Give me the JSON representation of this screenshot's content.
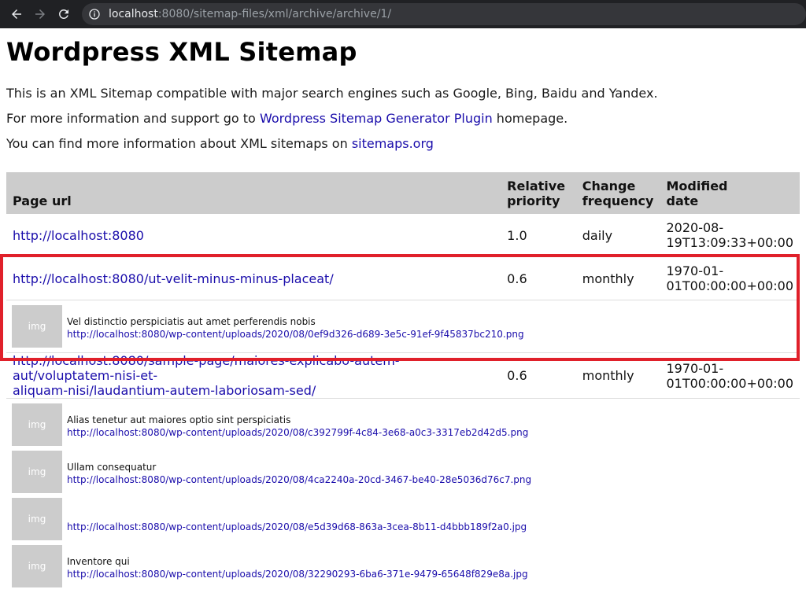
{
  "browser": {
    "url_host": "localhost",
    "url_rest": ":8080/sitemap-files/xml/archive/archive/1/"
  },
  "page": {
    "title": "Wordpress XML Sitemap",
    "intro_line1": "This is an XML Sitemap compatible with major search engines such as Google, Bing, Baidu and Yandex.",
    "intro_line2_prefix": "For more information and support go to ",
    "intro_line2_link": "Wordpress Sitemap Generator Plugin",
    "intro_line2_suffix": " homepage.",
    "intro_line3_prefix": "You can find more information about XML sitemaps on ",
    "intro_line3_link": "sitemaps.org"
  },
  "table": {
    "headers": {
      "url": "Page url",
      "priority_line1": "Relative",
      "priority_line2": "priority",
      "freq_line1": "Change",
      "freq_line2": "frequency",
      "date_line1": "Modified",
      "date_line2": "date"
    },
    "rows": [
      {
        "url": "http://localhost:8080",
        "priority": "1.0",
        "freq": "daily",
        "date_line1": "2020-08-",
        "date_line2": "19T13:09:33+00:00",
        "images": []
      },
      {
        "url": "http://localhost:8080/ut-velit-minus-minus-placeat/",
        "priority": "0.6",
        "freq": "monthly",
        "date_line1": "1970-01-",
        "date_line2": "01T00:00:00+00:00",
        "images": [
          {
            "thumb": "img",
            "caption": "Vel distinctio perspiciatis aut amet perferendis nobis",
            "url": "http://localhost:8080/wp-content/uploads/2020/08/0ef9d326-d689-3e5c-91ef-9f45837bc210.png"
          }
        ]
      },
      {
        "url_line1": "http://localhost:8080/sample-page/maiores-explicabo-autem-aut/voluptatem-nisi-et-",
        "url_line2": "aliquam-nisi/laudantium-autem-laboriosam-sed/",
        "priority": "0.6",
        "freq": "monthly",
        "date_line1": "1970-01-",
        "date_line2": "01T00:00:00+00:00",
        "images": [
          {
            "thumb": "img",
            "caption": "Alias tenetur aut maiores optio sint perspiciatis",
            "url": "http://localhost:8080/wp-content/uploads/2020/08/c392799f-4c84-3e68-a0c3-3317eb2d42d5.png"
          },
          {
            "thumb": "img",
            "caption": "Ullam consequatur",
            "url": "http://localhost:8080/wp-content/uploads/2020/08/4ca2240a-20cd-3467-be40-28e5036d76c7.png"
          },
          {
            "thumb": "img",
            "caption": "",
            "url": "http://localhost:8080/wp-content/uploads/2020/08/e5d39d68-863a-3cea-8b11-d4bbb189f2a0.jpg"
          },
          {
            "thumb": "img",
            "caption": "Inventore qui",
            "url": "http://localhost:8080/wp-content/uploads/2020/08/32290293-6ba6-371e-9479-65648f829e8a.jpg"
          }
        ]
      }
    ]
  },
  "colors": {
    "link": "#1a0dab",
    "header_bg": "#cccccc",
    "highlight": "#e0202a",
    "chrome_bg": "#202124"
  },
  "icons": [
    "back-arrow-icon",
    "forward-arrow-icon",
    "reload-icon",
    "info-icon"
  ]
}
